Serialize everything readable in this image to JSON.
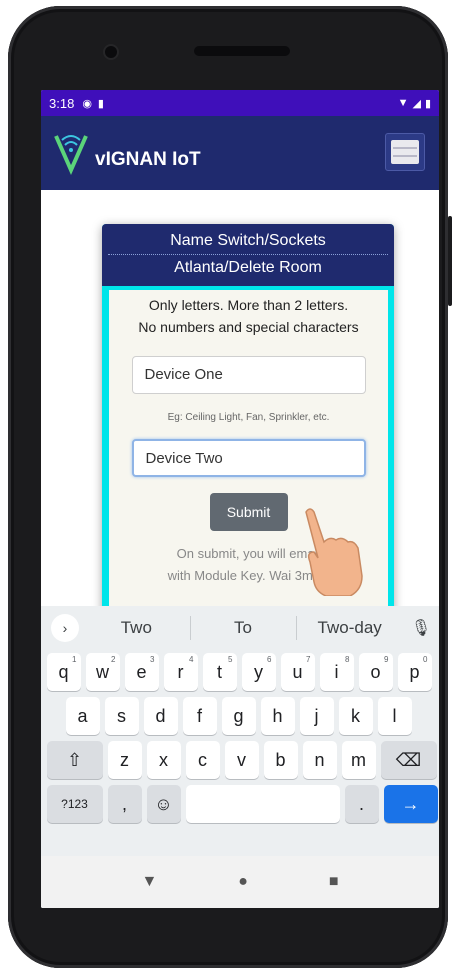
{
  "status_bar": {
    "time": "3:18"
  },
  "app": {
    "title": "vIGNAN IoT"
  },
  "card": {
    "header_line1": "Name Switch/Sockets",
    "header_line2": "Atlanta/Delete Room",
    "instruction_line1": "Only letters. More than 2 letters.",
    "instruction_line2": "No numbers and special characters",
    "field1_value": "Device One",
    "example_text": "Eg: Ceiling Light, Fan, Sprinkler, etc.",
    "field2_value": "Device Two",
    "submit_label": "Submit",
    "note_line1": "On submit, you will        email",
    "note_line2": "with Module Key. Wai       3mins"
  },
  "keyboard": {
    "suggestions": [
      "Two",
      "To",
      "Two-day"
    ],
    "row1": [
      {
        "k": "q",
        "n": "1"
      },
      {
        "k": "w",
        "n": "2"
      },
      {
        "k": "e",
        "n": "3"
      },
      {
        "k": "r",
        "n": "4"
      },
      {
        "k": "t",
        "n": "5"
      },
      {
        "k": "y",
        "n": "6"
      },
      {
        "k": "u",
        "n": "7"
      },
      {
        "k": "i",
        "n": "8"
      },
      {
        "k": "o",
        "n": "9"
      },
      {
        "k": "p",
        "n": "0"
      }
    ],
    "row2": [
      "a",
      "s",
      "d",
      "f",
      "g",
      "h",
      "j",
      "k",
      "l"
    ],
    "row3": [
      "z",
      "x",
      "c",
      "v",
      "b",
      "n",
      "m"
    ],
    "symbols_label": "?123",
    "comma": ",",
    "period": "."
  },
  "icons": {
    "shift": "shift-icon",
    "backspace": "backspace-icon",
    "emoji": "emoji-icon",
    "enter": "enter-arrow-icon",
    "mic": "mic-icon",
    "back": "nav-back-icon",
    "home": "nav-home-icon",
    "recents": "nav-recents-icon"
  },
  "colors": {
    "status_bar": "#3f0fba",
    "app_bar": "#1f2a6e",
    "card_border": "#00e5ea",
    "submit": "#616971",
    "enter_key": "#1a73e8"
  }
}
